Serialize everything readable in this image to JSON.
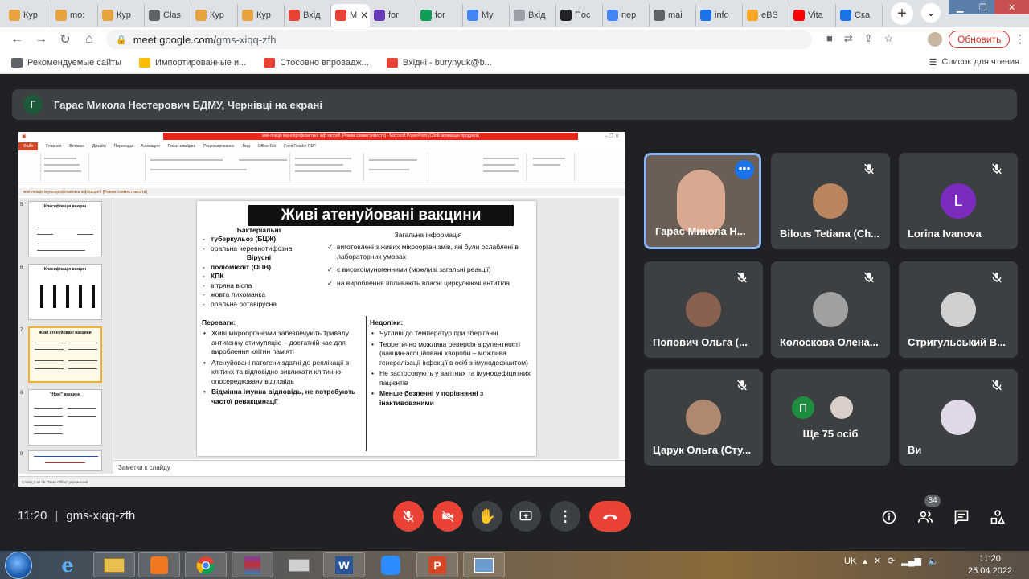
{
  "browser": {
    "tabs": [
      {
        "label": "Кур",
        "color": "#e8a33c"
      },
      {
        "label": "mo:",
        "color": "#e8a33c"
      },
      {
        "label": "Кур",
        "color": "#e8a33c"
      },
      {
        "label": "Clas",
        "color": "#5f6368"
      },
      {
        "label": "Кур",
        "color": "#e8a33c"
      },
      {
        "label": "Кур",
        "color": "#e8a33c"
      },
      {
        "label": "Вхід",
        "color": "#ea4335"
      },
      {
        "label": "M",
        "color": "#ea4335"
      },
      {
        "label": "for",
        "color": "#673ab7"
      },
      {
        "label": "for",
        "color": "#0f9d58"
      },
      {
        "label": "My",
        "color": "#4285f4"
      },
      {
        "label": "Вхід",
        "color": "#9aa0a6"
      },
      {
        "label": "Пос",
        "color": "#202124"
      },
      {
        "label": "пер",
        "color": "#4285f4"
      },
      {
        "label": "mai",
        "color": "#5f6368"
      },
      {
        "label": "info",
        "color": "#1a73e8"
      },
      {
        "label": "eBS",
        "color": "#f9a825"
      },
      {
        "label": "Vita",
        "color": "#ff0000"
      },
      {
        "label": "Ска",
        "color": "#1a73e8"
      }
    ],
    "url_host": "meet.google.com/",
    "url_path": "gms-xiqq-zfh",
    "update_label": "Обновить",
    "bookmarks": [
      {
        "label": "Рекомендуемые сайты",
        "color": "#5f6368"
      },
      {
        "label": "Импортированные и...",
        "color": "#fbbc04"
      },
      {
        "label": "Стосовно впровадж...",
        "color": "#ea4335"
      },
      {
        "label": "Вхідні - burynyuk@b...",
        "color": "#ea4335"
      }
    ],
    "reading_list": "Список для чтения"
  },
  "meet": {
    "presenter_initial": "Г",
    "presenter_text": "Гарас Микола Нестерович БДМУ, Чернівці на екрані",
    "meeting_time": "11:20",
    "meeting_code": "gms-xiqq-zfh",
    "participants_count": "84",
    "participants": [
      {
        "name": "Гарас Микола Н...",
        "initial": ""
      },
      {
        "name": "Bilous Tetiana (Ch...",
        "initial": ""
      },
      {
        "name": "Lorina Ivanova",
        "initial": "L"
      },
      {
        "name": "Попович Ольга (...",
        "initial": ""
      },
      {
        "name": "Колоскова Олена...",
        "initial": ""
      },
      {
        "name": "Стригульський В...",
        "initial": ""
      },
      {
        "name": "Царук Ольга (Сту...",
        "initial": ""
      },
      {
        "name": "Ще 75 осіб",
        "initial": "П"
      },
      {
        "name": "Ви",
        "initial": ""
      }
    ],
    "colors": {
      "lorina": "#7b2cbf",
      "more": "#1e8e3e",
      "accent": "#8ab4f8",
      "danger": "#ea4335"
    }
  },
  "powerpoint": {
    "window_title": "міні-лекція імунопрофілактика інф хвороб [Режим совместимости] - Microsoft PowerPoint (Сбой активации продукта)",
    "menu": [
      "Файл",
      "Главная",
      "Вставка",
      "Дизайн",
      "Переходы",
      "Анимация",
      "Показ слайдов",
      "Рецензирование",
      "Вид",
      "Office Tab",
      "Foxit Reader PDF"
    ],
    "doc_tab": "міні-лекція імунопрофілактика інф хвороб [Режим совместимости]",
    "thumb_numbers": [
      "5",
      "6",
      "7",
      "8",
      "9"
    ],
    "thumb_titles": [
      "Класифікація вакцин",
      "Класифікація вакцин",
      "Живі атенуйовані вакцини",
      "\"Нові\" вакцини",
      ""
    ],
    "notes": "Заметки к слайду",
    "status": "Слайд 7 из 16   \"Тема Office\"   украинский"
  },
  "slide": {
    "title": "Живі атенуйовані вакцини",
    "bacterial_heading": "Бактеріальні",
    "bacterial": [
      "туберкульоз (БЦЖ)",
      "оральна черевнотифозна"
    ],
    "viral_heading": "Вірусні",
    "viral": [
      "поліомієліт (ОПВ)",
      "КПК",
      "вітряна віспа",
      "жовта лихоманка",
      "оральна ротавірусна"
    ],
    "general_heading": "Загальна інформація",
    "general": [
      "виготовлені з живих мікроорганізмів, які були ослаблені в лабораторних умовах",
      "є високоімуногенними (можливі загальні реакції)",
      "на вироблення впливають власні циркулюючі антитіла"
    ],
    "adv_heading": "Переваги:",
    "advantages": [
      "Живі мікроорганізми забезпечують тривалу антигенну стимуляцію – достатній час для вироблення клітин пам'яті",
      "Атенуйовані патогени здатні до реплікації в клітинх та відповідно викликати клітинно-опосередковану відповідь",
      "Відмінна імунна відповідь, не потребують частої ревакцинації"
    ],
    "dis_heading": "Недоліки:",
    "disadvantages": [
      "Чутливі до температур при зберіганні",
      "Теоретично можлива реверсія вірулентності (вакцин-асоційовані хвороби – можлива генералізації інфекції в осіб з імунодефіцитом)",
      "Не застосовують у вагітних та імунодефіцитних пацієнтів",
      "Менше безпечні у порівнянні з інактивованими"
    ]
  },
  "taskbar": {
    "lang": "UK",
    "time": "11:20",
    "date": "25.04.2022"
  }
}
